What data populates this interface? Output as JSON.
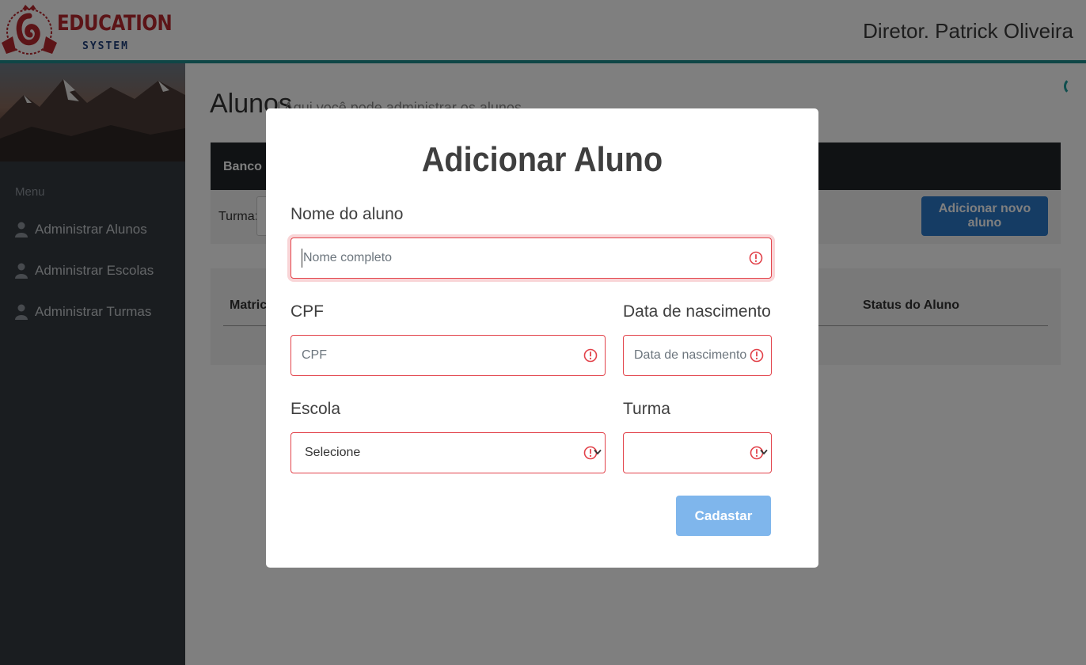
{
  "header": {
    "logo_title": "EDUCATION",
    "logo_subtitle": "SYSTEM",
    "user_name": "Diretor. Patrick Oliveira"
  },
  "sidebar": {
    "menu_heading": "Menu",
    "items": [
      {
        "label": "Administrar Alunos",
        "icon": "user-icon"
      },
      {
        "label": "Administrar Escolas",
        "icon": "user-icon"
      },
      {
        "label": "Administrar Turmas",
        "icon": "user-icon"
      }
    ]
  },
  "main": {
    "title": "Alunos",
    "subtitle": "| Aqui você pode administrar os alunos",
    "card_title": "Banco de",
    "filter_label": "Turma:",
    "add_button": "Adicionar novo aluno",
    "table_headers": [
      "Matricu",
      "Status do Aluno"
    ]
  },
  "modal": {
    "title": "Adicionar Aluno",
    "fields": {
      "nome": {
        "label": "Nome do aluno",
        "placeholder": "Nome completo"
      },
      "cpf": {
        "label": "CPF",
        "placeholder": "CPF"
      },
      "nascimento": {
        "label": "Data de nascimento",
        "placeholder": "Data de nascimento"
      },
      "escola": {
        "label": "Escola",
        "value": "Selecione"
      },
      "turma": {
        "label": "Turma",
        "value": ""
      }
    },
    "submit": "Cadastar"
  },
  "colors": {
    "accent": "#1f8c8c",
    "error": "#e2424a",
    "primary_button": "#2a78c8",
    "submit_disabled": "#7fb6ec",
    "sidebar_bg": "#343a40"
  }
}
